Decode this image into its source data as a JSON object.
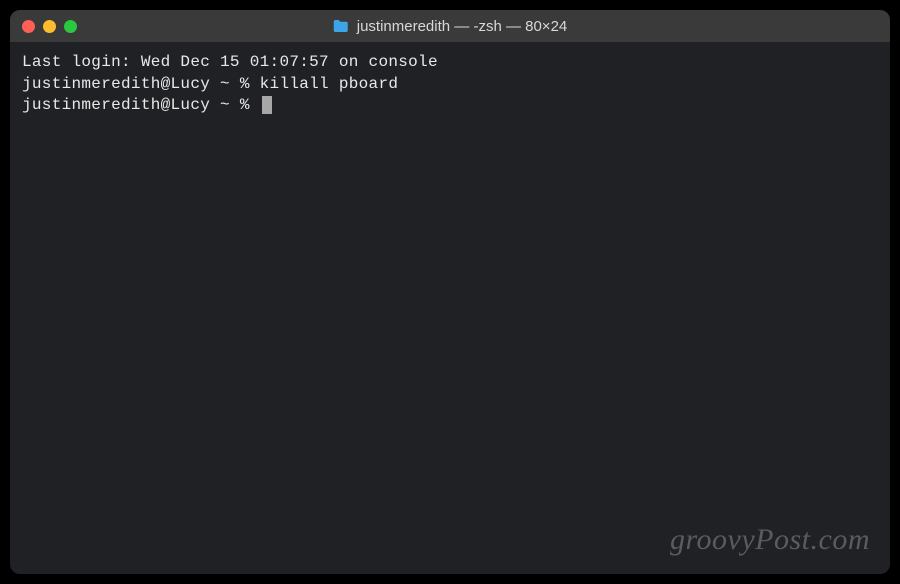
{
  "window": {
    "title": "justinmeredith — -zsh — 80×24",
    "icon": "folder-icon",
    "traffic_lights": {
      "close": "close",
      "minimize": "minimize",
      "maximize": "maximize"
    }
  },
  "terminal": {
    "lines": [
      "Last login: Wed Dec 15 01:07:57 on console",
      "justinmeredith@Lucy ~ % killall pboard",
      "justinmeredith@Lucy ~ % "
    ]
  },
  "watermark": "groovyPost.com"
}
